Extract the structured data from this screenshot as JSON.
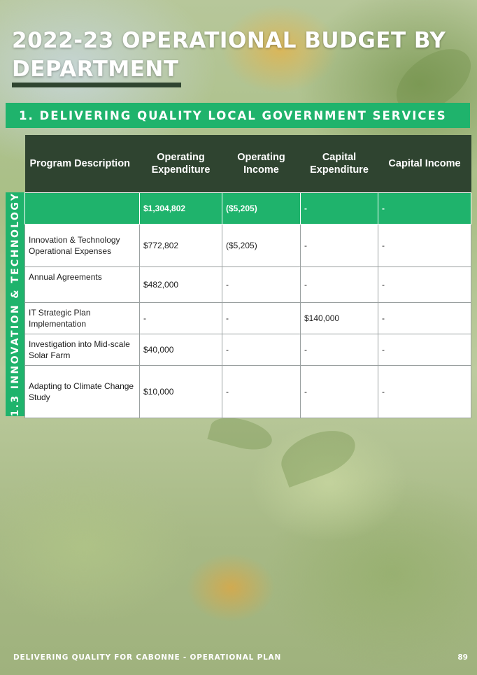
{
  "page": {
    "title": "2022-23 OPERATIONAL BUDGET BY DEPARTMENT",
    "section_heading": "1. DELIVERING QUALITY LOCAL GOVERNMENT SERVICES",
    "side_label": "1.3 INNOVATION & TECHNOLOGY"
  },
  "table": {
    "headers": [
      "Program Description",
      "Operating Expenditure",
      "Operating Income",
      "Capital Expenditure",
      "Capital Income"
    ],
    "total_row": [
      "",
      "$1,304,802",
      "($5,205)",
      "-",
      "-"
    ],
    "rows": [
      [
        "Innovation & Technology Operational Expenses",
        "$772,802",
        "($5,205)",
        "-",
        "-"
      ],
      [
        "Annual Agreements",
        "$482,000",
        "-",
        "-",
        "-"
      ],
      [
        "IT Strategic Plan Implementation",
        "-",
        "-",
        "$140,000",
        "-"
      ],
      [
        "Investigation into Mid-scale Solar Farm",
        "$40,000",
        "-",
        "-",
        "-"
      ],
      [
        "Adapting to Climate Change Study",
        "$10,000",
        "-",
        "-",
        "-"
      ]
    ]
  },
  "footer": {
    "left": "DELIVERING QUALITY FOR CABONNE - OPERATIONAL PLAN",
    "page_number": "89"
  },
  "colors": {
    "accent_green": "#1fb36c",
    "dark_green": "#2f4430"
  }
}
